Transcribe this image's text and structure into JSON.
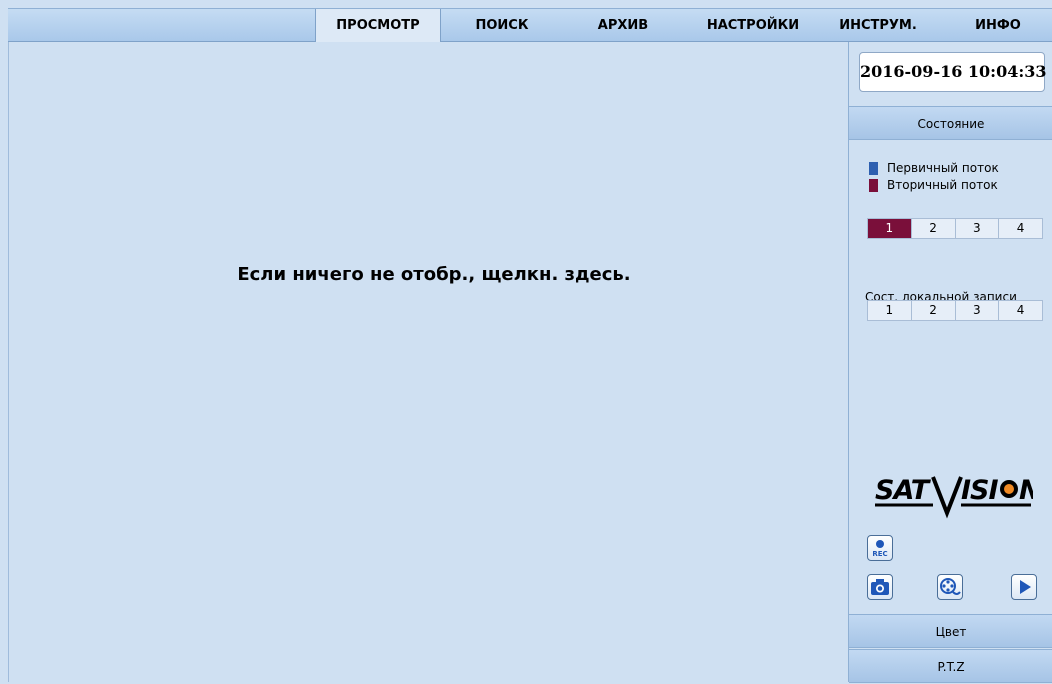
{
  "nav": {
    "tabs": [
      {
        "label": "ПРОСМОТР"
      },
      {
        "label": "ПОИСК"
      },
      {
        "label": "АРХИВ"
      },
      {
        "label": "НАСТРОЙКИ"
      },
      {
        "label": "ИНСТРУМ."
      },
      {
        "label": "ИНФО"
      }
    ],
    "active_tab": "ПРОСМОТР"
  },
  "main": {
    "hint": "Если ничего не отобр., щелкн. здесь."
  },
  "side": {
    "datetime": "2016-09-16 10:04:33",
    "status_header": "Состояние",
    "legend": [
      {
        "label": "Первичный поток",
        "color": "#2d5fb0"
      },
      {
        "label": "Вторичный поток",
        "color": "#7a0f3a"
      }
    ],
    "stream_channels": [
      "1",
      "2",
      "3",
      "4"
    ],
    "selected_stream_channel": "1",
    "local_record_label": "Сост. локальной записи",
    "record_channels": [
      "1",
      "2",
      "3",
      "4"
    ],
    "logo_text": "SATVISION",
    "icons": {
      "rec": "rec-icon",
      "snapshot": "camera-icon",
      "video": "film-reel-icon",
      "play": "play-icon"
    },
    "rec_text": "REC",
    "color_header": "Цвет",
    "ptz_header": "P.T.Z"
  },
  "colors": {
    "accent": "#2d5fb0",
    "selected": "#7a0f3a",
    "background": "#cfe0f2"
  }
}
